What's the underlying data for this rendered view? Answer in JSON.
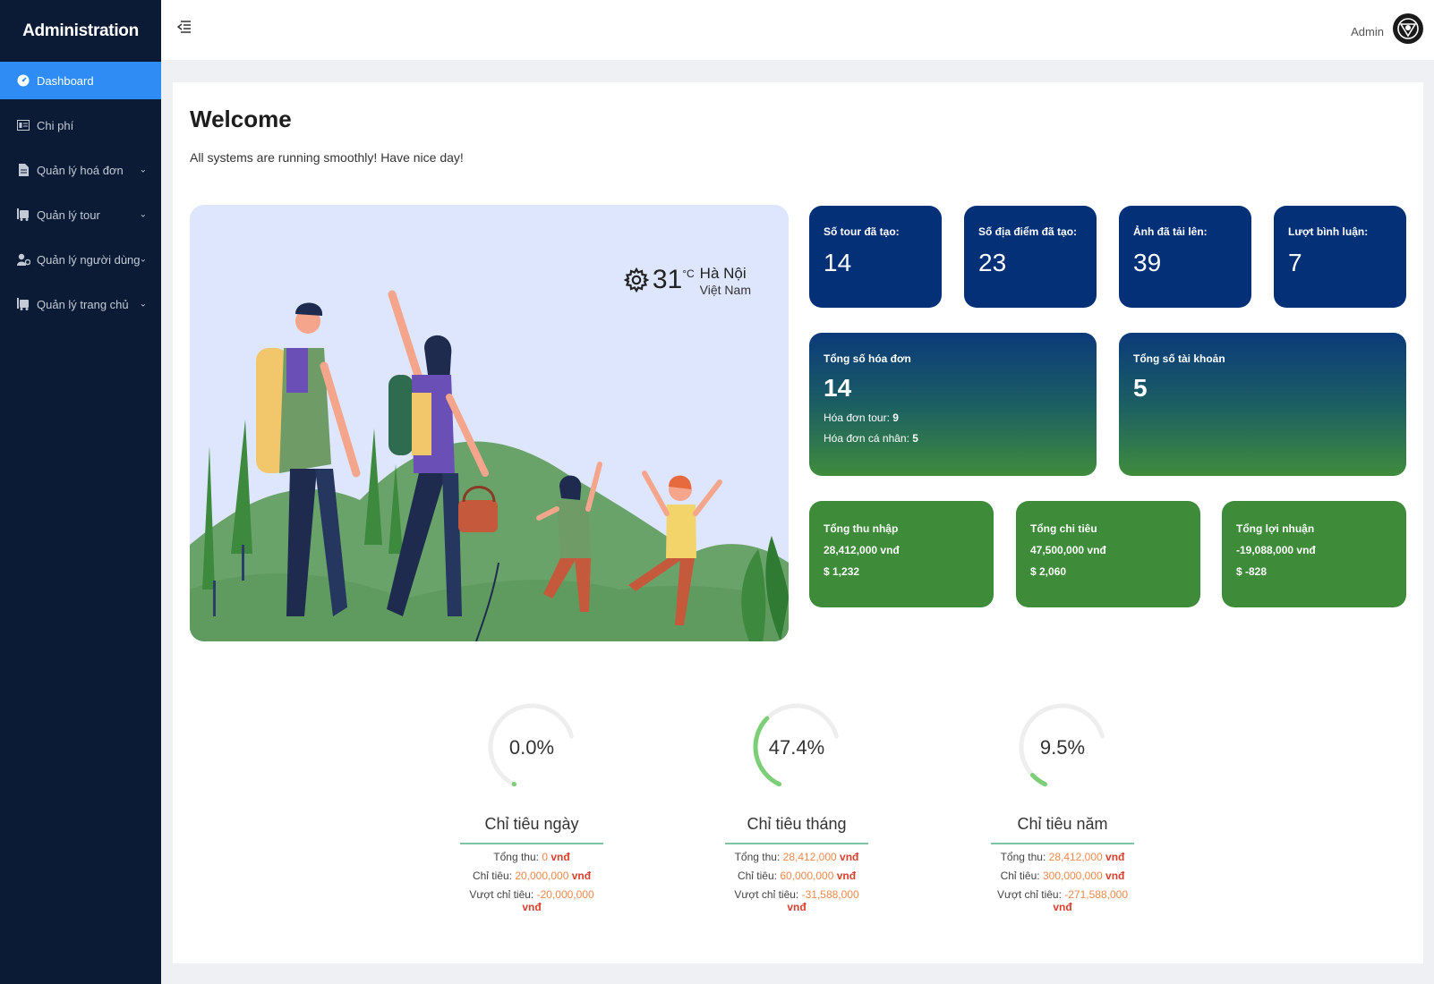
{
  "sidebar": {
    "brand": "Administration",
    "items": [
      {
        "label": "Dashboard",
        "icon": "dashboard-icon"
      },
      {
        "label": "Chi phí",
        "icon": "expense-icon"
      },
      {
        "label": "Quản lý hoá đơn",
        "icon": "invoice-icon"
      },
      {
        "label": "Quản lý tour",
        "icon": "tour-icon"
      },
      {
        "label": "Quản lý người dùng",
        "icon": "users-icon"
      },
      {
        "label": "Quản lý trang chủ",
        "icon": "home-icon"
      }
    ]
  },
  "header": {
    "user": "Admin"
  },
  "main": {
    "title": "Welcome",
    "subtitle": "All systems are running smoothly! Have nice day!",
    "weather": {
      "temp": "31",
      "unit": "°C",
      "city": "Hà Nội",
      "country": "Việt Nam"
    },
    "stats": [
      {
        "label": "Số tour đã tạo:",
        "value": "14"
      },
      {
        "label": "Số địa điểm đã tạo:",
        "value": "23"
      },
      {
        "label": "Ảnh đã tải lên:",
        "value": "39"
      },
      {
        "label": "Lượt bình luận:",
        "value": "7"
      }
    ],
    "invoices": {
      "label": "Tổng số hóa đơn",
      "value": "14",
      "tour_label": "Hóa đơn tour:",
      "tour_value": "9",
      "personal_label": "Hóa đơn cá nhân:",
      "personal_value": "5"
    },
    "accounts": {
      "label": "Tổng số tài khoản",
      "value": "5"
    },
    "finance": [
      {
        "label": "Tổng thu nhập",
        "vnd": "28,412,000 vnđ",
        "usd": "$ 1,232"
      },
      {
        "label": "Tổng chi tiêu",
        "vnd": "47,500,000 vnđ",
        "usd": "$ 2,060"
      },
      {
        "label": "Tổng lợi nhuận",
        "vnd": "-19,088,000 vnđ",
        "usd": "$ -828"
      }
    ],
    "gauges": [
      {
        "pct_text": "0.0%",
        "pct": 0.0,
        "title": "Chỉ tiêu ngày",
        "revenue_label": "Tổng thu:",
        "revenue": "0",
        "target_label": "Chỉ tiêu:",
        "target": "20,000,000",
        "over_label": "Vượt chỉ tiêu:",
        "over": "-20,000,000",
        "currency": "vnđ"
      },
      {
        "pct_text": "47.4%",
        "pct": 0.474,
        "title": "Chỉ tiêu tháng",
        "revenue_label": "Tổng thu:",
        "revenue": "28,412,000",
        "target_label": "Chỉ tiêu:",
        "target": "60,000,000",
        "over_label": "Vượt chỉ tiêu:",
        "over": "-31,588,000",
        "currency": "vnđ"
      },
      {
        "pct_text": "9.5%",
        "pct": 0.095,
        "title": "Chỉ tiêu năm",
        "revenue_label": "Tổng thu:",
        "revenue": "28,412,000",
        "target_label": "Chỉ tiêu:",
        "target": "300,000,000",
        "over_label": "Vượt chỉ tiêu:",
        "over": "-271,588,000",
        "currency": "vnđ"
      }
    ]
  },
  "colors": {
    "sidebar_bg": "#0b1b36",
    "active": "#2f8cf5",
    "stat_blue": "#043078",
    "stat_green": "#3e8b3a",
    "gauge_fill": "#7ccf77",
    "gauge_track": "#eeeeee"
  }
}
